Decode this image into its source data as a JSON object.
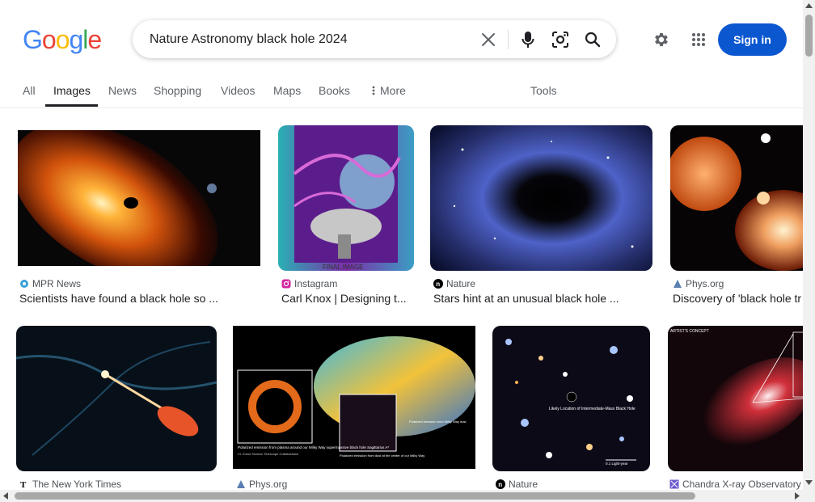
{
  "logo": {
    "letters": [
      "G",
      "o",
      "o",
      "g",
      "l",
      "e"
    ],
    "colors": [
      "#4285F4",
      "#EA4335",
      "#FBBC05",
      "#4285F4",
      "#34A853",
      "#EA4335"
    ]
  },
  "search": {
    "query": "Nature Astronomy black hole 2024"
  },
  "header": {
    "signin_label": "Sign in"
  },
  "tabs": [
    {
      "label": "All"
    },
    {
      "label": "Images",
      "active": true
    },
    {
      "label": "News"
    },
    {
      "label": "Shopping"
    },
    {
      "label": "Videos"
    },
    {
      "label": "Maps"
    },
    {
      "label": "Books"
    },
    {
      "label": "More"
    },
    {
      "label": "Tools"
    }
  ],
  "results": [
    {
      "source": "MPR News",
      "title": "Scientists have found a black hole so ...",
      "favicon": "mpr-icon"
    },
    {
      "source": "Instagram",
      "title": "Carl Knox | Designing t...",
      "favicon": "instagram-icon",
      "image_caption": "FINAL IMAGE"
    },
    {
      "source": "Nature",
      "title": "Stars hint at an unusual black hole ...",
      "favicon": "nature-icon"
    },
    {
      "source": "Phys.org",
      "title": "Discovery of 'black hole tr",
      "favicon": "physorg-icon"
    },
    {
      "source": "The New York Times",
      "title": "",
      "favicon": "nyt-icon"
    },
    {
      "source": "Phys.org",
      "title": "",
      "favicon": "physorg-icon",
      "image_texts": [
        "Polarized emission from plasma around our Milky Way supermassive black hole Sagittarius A*",
        "Cr. Event Horizon Telescope Collaboration",
        "Polarized emission from dust at the center of our Milky Way",
        "Polarized emission from Milky Way dust"
      ]
    },
    {
      "source": "Nature",
      "title": "",
      "favicon": "nature-icon",
      "image_texts": [
        "Likely Location of Intermediate-Mass Black Hole",
        "0.1 Light-year"
      ]
    },
    {
      "source": "Chandra X-ray Observatory",
      "title": "",
      "favicon": "chandra-icon",
      "image_texts": [
        "ARTIST'S CONCEPT"
      ]
    }
  ]
}
